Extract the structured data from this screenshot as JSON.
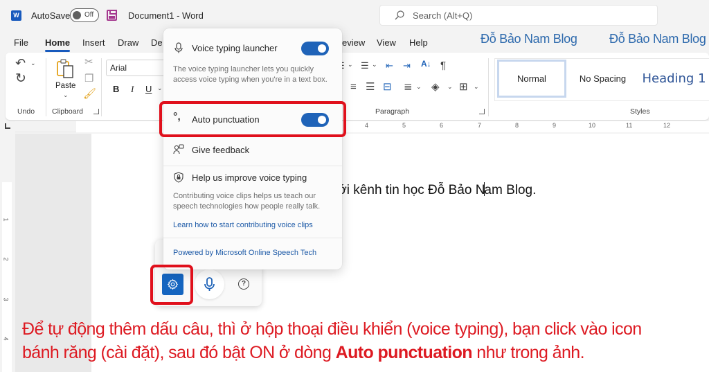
{
  "titlebar": {
    "app_icon": "word-logo-icon",
    "app_letter": "W",
    "autosave_label": "AutoSave",
    "autosave_state": "Off",
    "save_icon": "save-icon",
    "document_title": "Document1  -  Word",
    "search_placeholder": "Search (Alt+Q)"
  },
  "tabs": [
    {
      "label": "File",
      "active": false
    },
    {
      "label": "Home",
      "active": true
    },
    {
      "label": "Insert",
      "active": false
    },
    {
      "label": "Draw",
      "active": false
    },
    {
      "label": "De",
      "active": false
    },
    {
      "label": "eview",
      "active": false
    },
    {
      "label": "View",
      "active": false
    },
    {
      "label": "Help",
      "active": false
    }
  ],
  "watermarks": [
    "Đỗ Bảo Nam Blog",
    "Đỗ Bảo Nam Blog"
  ],
  "ribbon": {
    "groups": {
      "undo": "Undo",
      "clipboard": "Clipboard",
      "paragraph": "Paragraph",
      "styles": "Styles"
    },
    "paste_label": "Paste",
    "font_name": "Arial",
    "font_buttons": [
      "B",
      "I",
      "U"
    ],
    "styles": [
      "Normal",
      "No Spacing",
      "Heading 1"
    ],
    "selected_style": "Normal"
  },
  "ruler": {
    "h_numbers": [
      "4",
      "5",
      "6",
      "7",
      "8",
      "9",
      "10",
      "11",
      "12"
    ],
    "v_numbers": [
      "1",
      "2",
      "3",
      "4"
    ]
  },
  "document": {
    "text_before_caret": "n với kênh tin học Đỗ Bảo N",
    "text_after_caret": "am Blog."
  },
  "voice_settings": {
    "launcher": {
      "title": "Voice typing launcher",
      "enabled": true,
      "description": "The voice typing launcher lets you quickly access voice typing when you're in a text box."
    },
    "auto_punctuation": {
      "title": "Auto punctuation",
      "enabled": true
    },
    "feedback_label": "Give feedback",
    "improve": {
      "title": "Help us improve voice typing",
      "description": "Contributing voice clips helps us teach our speech technologies how people really talk.",
      "link": "Learn how to start contributing voice clips"
    },
    "powered_by": "Powered by Microsoft Online Speech Tech"
  },
  "voice_toolbar": {
    "settings_icon": "gear-icon",
    "mic_icon": "microphone-icon",
    "help_icon": "help-icon",
    "help_glyph": "?"
  },
  "caption": {
    "line1": "Để tự động thêm dấu câu, thì ở hộp thoại điều khiển (voice typing), bạn click vào icon",
    "line2_start": "bánh răng (cài đặt), sau đó bật ON ở dòng ",
    "line2_bold": "Auto punctuation",
    "line2_end": " như trong ảnh."
  },
  "colors": {
    "accent": "#185abd",
    "toggle_on": "#1f63b8",
    "highlight": "#e0101c",
    "caption": "#dd1a22",
    "brand": "#2e6aad"
  }
}
